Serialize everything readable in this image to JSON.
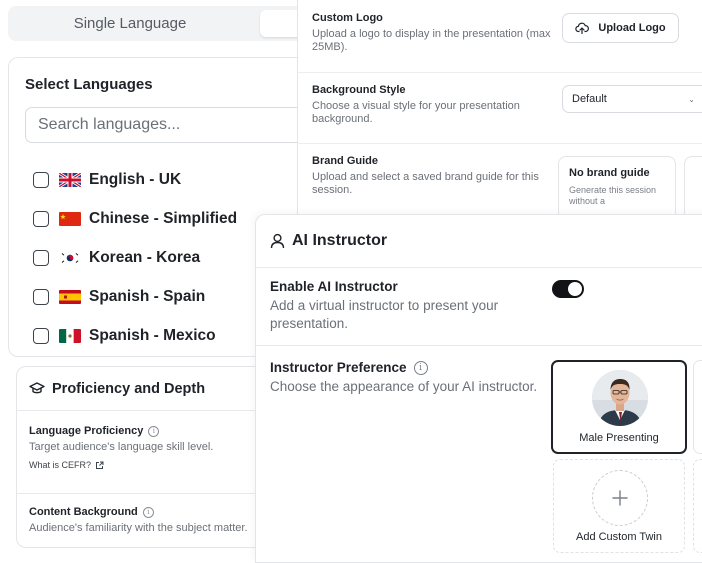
{
  "language_mode": {
    "single_label": "Single Language"
  },
  "select_languages": {
    "title": "Select Languages",
    "search_placeholder": "Search languages...",
    "items": [
      {
        "label": "English - UK",
        "flag": "uk-flag-icon",
        "checked": false
      },
      {
        "label": "Chinese - Simplified",
        "flag": "china-flag-icon",
        "checked": false
      },
      {
        "label": "Korean - Korea",
        "flag": "korea-flag-icon",
        "checked": false
      },
      {
        "label": "Spanish - Spain",
        "flag": "spain-flag-icon",
        "checked": false
      },
      {
        "label": "Spanish - Mexico",
        "flag": "mexico-flag-icon",
        "checked": false
      }
    ]
  },
  "proficiency": {
    "title": "Proficiency and Depth",
    "language_proficiency": {
      "title": "Language Proficiency",
      "desc": "Target audience's language skill level.",
      "link": "What is CEFR?"
    },
    "content_background": {
      "title": "Content Background",
      "desc": "Audience's familiarity with the subject matter."
    }
  },
  "settings": {
    "custom_logo": {
      "title": "Custom Logo",
      "desc": "Upload a logo to display in the presentation (max 25MB).",
      "button": "Upload Logo"
    },
    "background_style": {
      "title": "Background Style",
      "desc": "Choose a visual style for your presentation background.",
      "value": "Default"
    },
    "brand_guide": {
      "title": "Brand Guide",
      "desc": "Upload and select a saved brand guide for this session.",
      "card_title": "No brand guide",
      "card_desc": "Generate this session without a"
    }
  },
  "ai_instructor": {
    "title": "AI Instructor",
    "enable": {
      "title": "Enable AI Instructor",
      "desc": "Add a virtual instructor to present your presentation.",
      "on": true
    },
    "preference": {
      "title": "Instructor Preference",
      "desc": "Choose the appearance of your AI instructor.",
      "selected_label": "Male Presenting",
      "add_label": "Add Custom Twin"
    }
  },
  "colors": {
    "toggle_on": "#111316",
    "text_primary": "#1f2328",
    "text_muted": "#6b7078",
    "border": "#e3e5e8"
  }
}
